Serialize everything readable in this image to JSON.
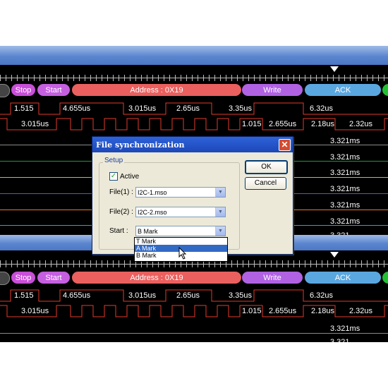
{
  "protocol_labels": [
    "Stop",
    "Start",
    "Address : 0X19",
    "Write",
    "ACK"
  ],
  "timing_top": [
    "1.515",
    "4.655us",
    "3.015us",
    "2.65us",
    "3.35us",
    "6.32us"
  ],
  "timing_bottom": [
    "3.015us",
    "1.015",
    "2.655us",
    "2.18us",
    "2.32us"
  ],
  "measure_value": "3.321ms",
  "measure_partial": "3.321",
  "dialog": {
    "title": "File synchronization",
    "close": "✕",
    "group_label": "Setup",
    "active_label": "Active",
    "file1_label": "File(1) :",
    "file1_value": "I2C-1.mso",
    "file2_label": "File(2) :",
    "file2_value": "I2C-2.mso",
    "start_label": "Start :",
    "start_value": "B Mark",
    "ok": "OK",
    "cancel": "Cancel"
  },
  "start_options": [
    "T Mark",
    "A Mark",
    "B Mark"
  ],
  "start_options_highlighted": "A Mark",
  "colors": {
    "stop": "#c84fd8",
    "start": "#c55fe0",
    "address": "#e9605e",
    "write": "#b062e3",
    "ack": "#5aa7e0",
    "signal": "#e23a2a",
    "accent": "#316ac5"
  }
}
